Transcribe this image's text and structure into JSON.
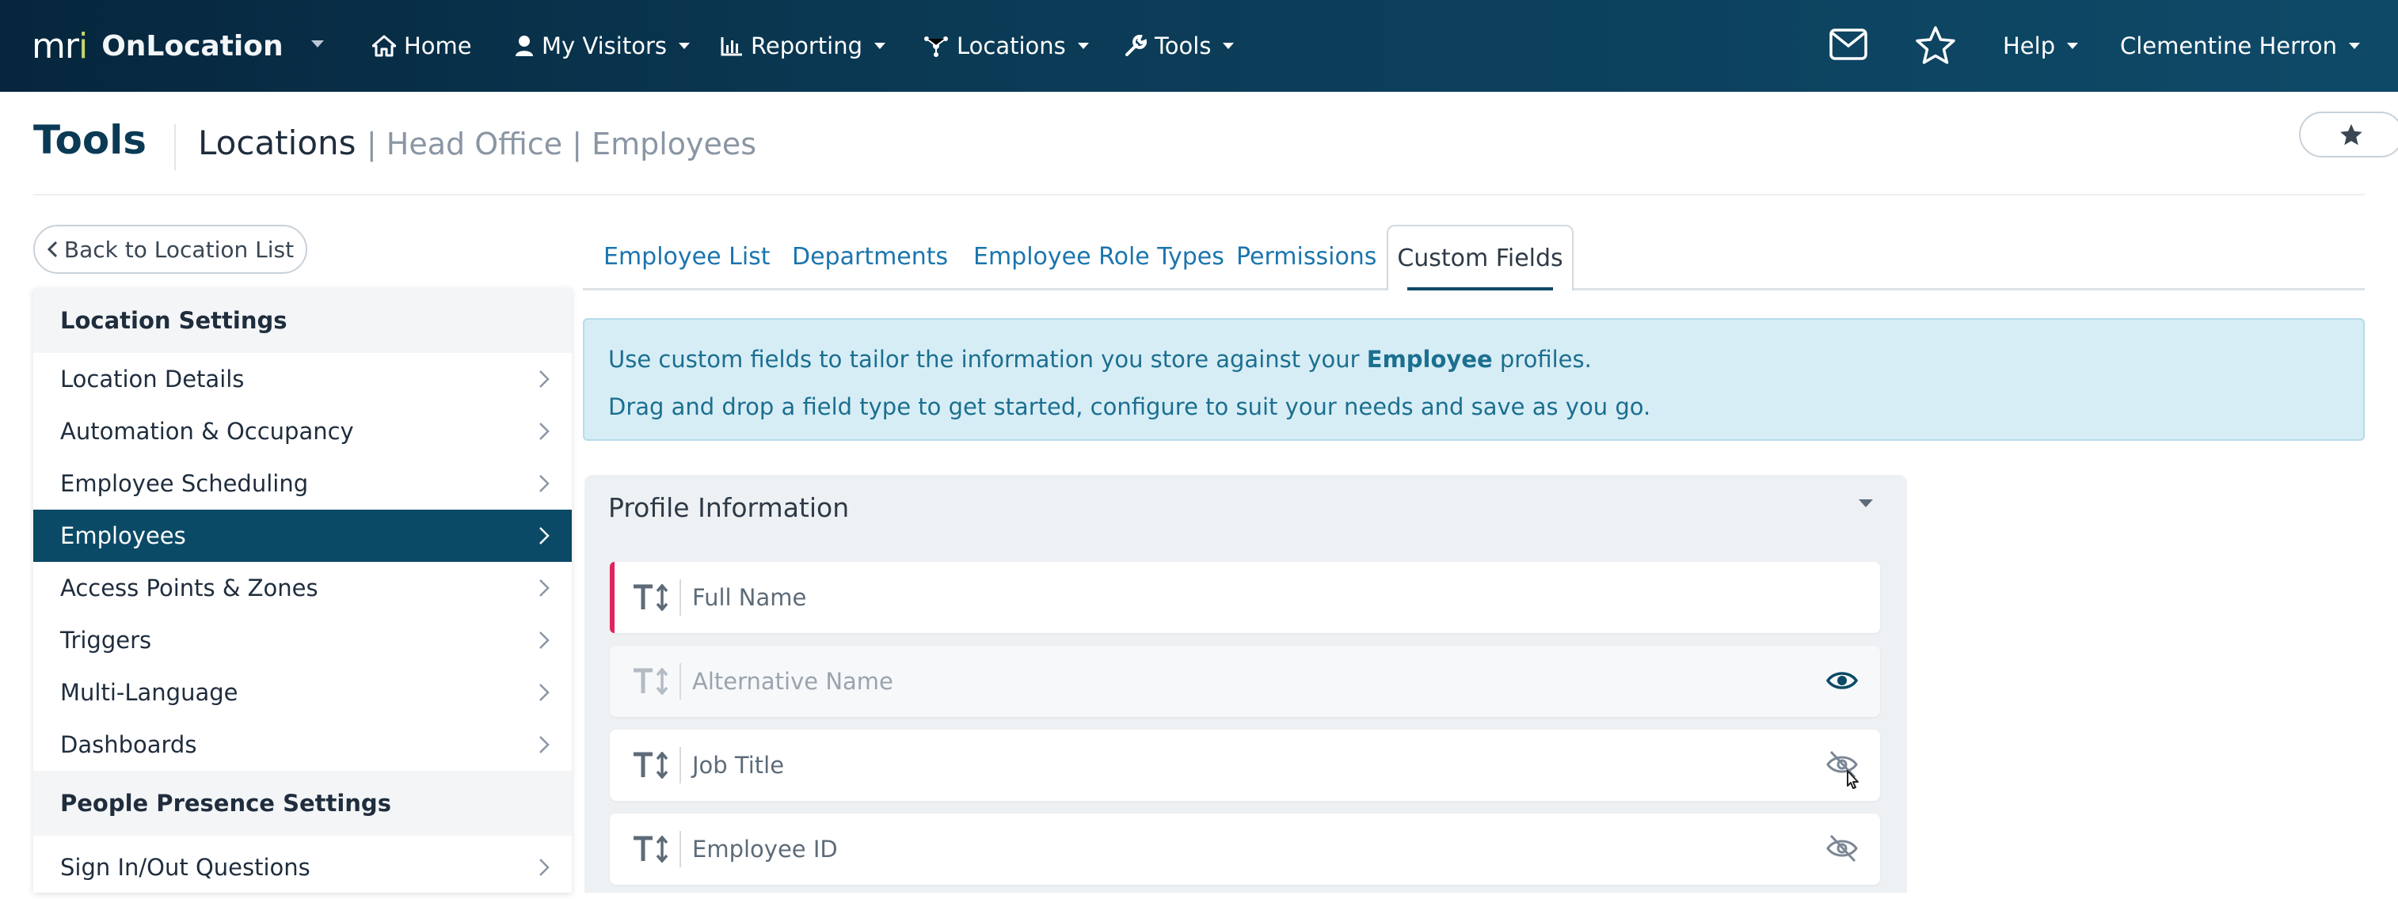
{
  "topbar": {
    "brand_mark": "mri",
    "brand_name": "OnLocation",
    "nav": [
      {
        "label": "Home",
        "icon": "home-icon"
      },
      {
        "label": "My Visitors",
        "icon": "person-icon"
      },
      {
        "label": "Reporting",
        "icon": "bar-chart-icon"
      },
      {
        "label": "Locations",
        "icon": "network-icon"
      },
      {
        "label": "Tools",
        "icon": "wrench-icon"
      }
    ],
    "help_label": "Help",
    "user_name": "Clementine Herron"
  },
  "header": {
    "title": "Tools",
    "crumb_main": "Locations",
    "crumb_rest": "| Head Office | Employees"
  },
  "back_button": "Back to Location List",
  "sidebar": {
    "section1": "Location Settings",
    "items": [
      {
        "label": "Location Details"
      },
      {
        "label": "Automation & Occupancy"
      },
      {
        "label": "Employee Scheduling"
      },
      {
        "label": "Employees"
      },
      {
        "label": "Access Points & Zones"
      },
      {
        "label": "Triggers"
      },
      {
        "label": "Multi-Language"
      },
      {
        "label": "Dashboards"
      }
    ],
    "section2": "People Presence Settings",
    "items2": [
      {
        "label": "Sign In/Out Questions"
      }
    ]
  },
  "tabs": [
    {
      "label": "Employee List"
    },
    {
      "label": "Departments"
    },
    {
      "label": "Employee Role Types"
    },
    {
      "label": "Permissions"
    },
    {
      "label": "Custom Fields"
    }
  ],
  "info": {
    "line1_pre": "Use custom fields to tailor the information you store against your",
    "line1_bold": "Employee",
    "line1_post": "profiles.",
    "line2": "Drag and drop a field type to get started, configure to suit your needs and save as you go."
  },
  "profile": {
    "title": "Profile Information",
    "fields": [
      {
        "name": "Full Name"
      },
      {
        "name": "Alternative Name"
      },
      {
        "name": "Job Title"
      },
      {
        "name": "Employee ID"
      }
    ]
  },
  "colors": {
    "nav_bg": "#0b3a55",
    "accent": "#0b4a66",
    "link": "#1b75ae",
    "info_bg": "#d7edf6",
    "required": "#e0245e"
  }
}
